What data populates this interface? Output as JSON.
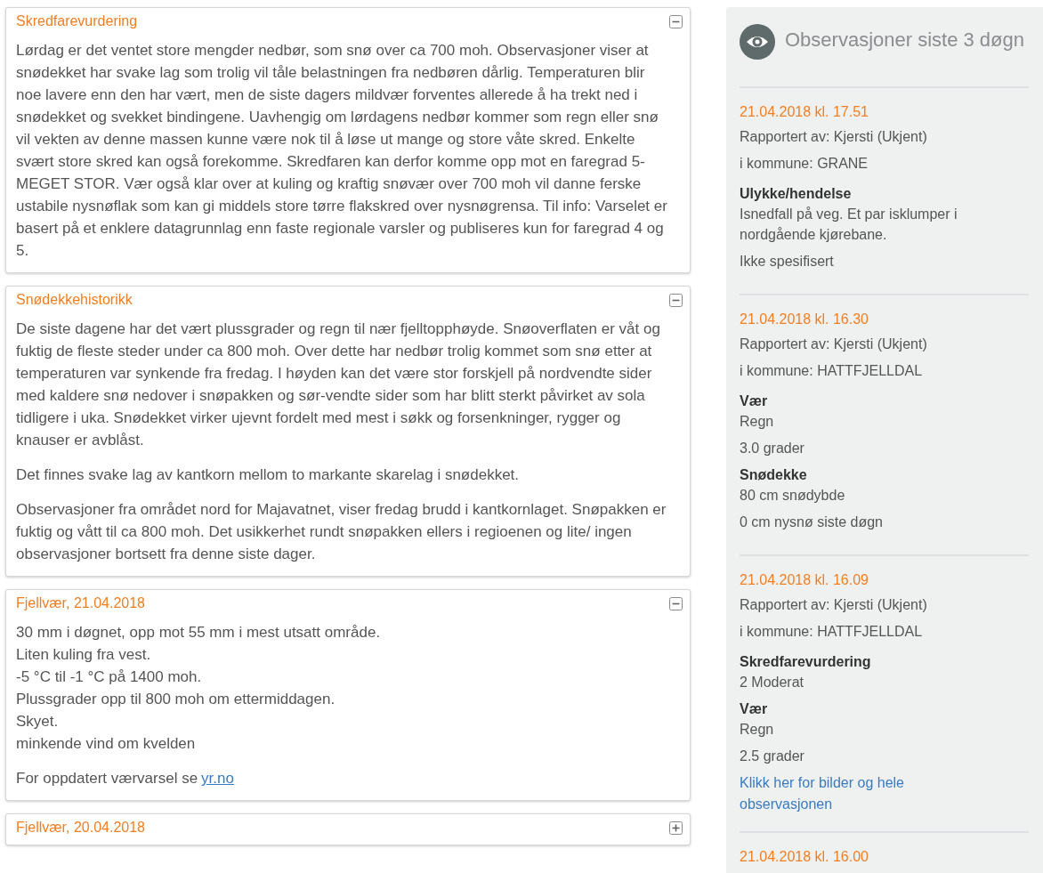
{
  "cards": [
    {
      "title": "Skredfarevurdering",
      "expanded": true,
      "paragraphs": [
        {
          "lines": [
            "Lørdag er det ventet store mengder nedbør, som snø over ca 700 moh. Observasjoner viser at snødekket har svake lag som trolig vil tåle belastningen fra nedbøren dårlig. Temperaturen blir noe lavere enn den har vært, men de siste dagers mildvær forventes allerede å ha trekt ned i snødekket og svekket bindingene. Uavhengig om lørdagens nedbør kommer som regn eller snø vil vekten av denne massen kunne være nok til å løse ut mange og store våte skred. Enkelte svært store skred kan også forekomme. Skredfaren kan derfor komme opp mot en faregrad 5-MEGET STOR. Vær også klar over at kuling og kraftig snøvær over 700 moh vil danne ferske ustabile nysnøflak som kan gi middels store tørre flakskred over nysnøgrensa. Til info: Varselet er basert på et enklere datagrunnlag enn faste regionale varsler og publiseres kun for faregrad 4 og 5."
          ]
        }
      ]
    },
    {
      "title": "Snødekkehistorikk",
      "expanded": true,
      "paragraphs": [
        {
          "lines": [
            "De siste dagene har det vært plussgrader og regn til nær fjelltopphøyde. Snøoverflaten er våt og fuktig de fleste steder under ca 800 moh. Over dette har nedbør trolig kommet som snø etter at temperaturen var synkende fra fredag. I høyden kan det være stor forskjell på nordvendte sider med kaldere snø nedover i snøpakken og sør-vendte sider som har blitt sterkt påvirket av sola tidligere i uka. Snødekket virker ujevnt fordelt med mest i søkk og forsenkninger, rygger og knauser er avblåst."
          ]
        },
        {
          "lines": [
            "Det finnes svake lag av kantkorn mellom to markante skarelag i snødekket."
          ]
        },
        {
          "lines": [
            "Observasjoner fra området nord for Majavatnet, viser fredag brudd i kantkornlaget. Snøpakken er fuktig og vått til ca 800 moh. Det usikkerhet rundt snøpakken ellers i regioenen og lite/ ingen observasjoner bortsett fra denne siste dager."
          ]
        }
      ]
    },
    {
      "title": "Fjellvær, 21.04.2018",
      "expanded": true,
      "paragraphs": [
        {
          "lines": [
            "30 mm i døgnet, opp mot 55 mm i mest utsatt område.",
            "Liten kuling fra vest.",
            "-5 °C til -1 °C på 1400 moh.",
            "Plussgrader opp til 800 moh om ettermiddagen.",
            "Skyet.",
            "minkende vind om kvelden"
          ]
        },
        {
          "lines": [
            "For oppdatert værvarsel se"
          ],
          "link": "yr.no"
        }
      ]
    },
    {
      "title": "Fjellvær, 20.04.2018",
      "expanded": false
    }
  ],
  "observations": {
    "title": "Observasjoner siste 3 døgn",
    "items": [
      {
        "date": "21.04.2018 kl. 17.51",
        "reporter": "Rapportert av: Kjersti (Ukjent)",
        "municipality": "i kommune: GRANE",
        "sections": [
          {
            "label": "Ulykke/hendelse",
            "values": [
              "Isnedfall på veg. Et par isklumper i nordgående kjørebane.",
              "Ikke spesifisert"
            ]
          }
        ]
      },
      {
        "date": "21.04.2018 kl. 16.30",
        "reporter": "Rapportert av: Kjersti (Ukjent)",
        "municipality": "i kommune: HATTFJELLDAL",
        "sections": [
          {
            "label": "Vær",
            "values": [
              "Regn",
              "3.0 grader"
            ]
          },
          {
            "label": "Snødekke",
            "values": [
              "80 cm snødybde",
              "0 cm nysnø siste døgn"
            ]
          }
        ]
      },
      {
        "date": "21.04.2018 kl. 16.09",
        "reporter": "Rapportert av: Kjersti (Ukjent)",
        "municipality": "i kommune: HATTFJELLDAL",
        "sections": [
          {
            "label": "Skredfarevurdering",
            "values": [
              "2 Moderat"
            ]
          },
          {
            "label": "Vær",
            "values": [
              "Regn",
              "2.5 grader"
            ]
          }
        ],
        "link": "Klikk her for bilder og hele observasjonen"
      },
      {
        "date": "21.04.2018 kl. 16.00"
      }
    ]
  }
}
